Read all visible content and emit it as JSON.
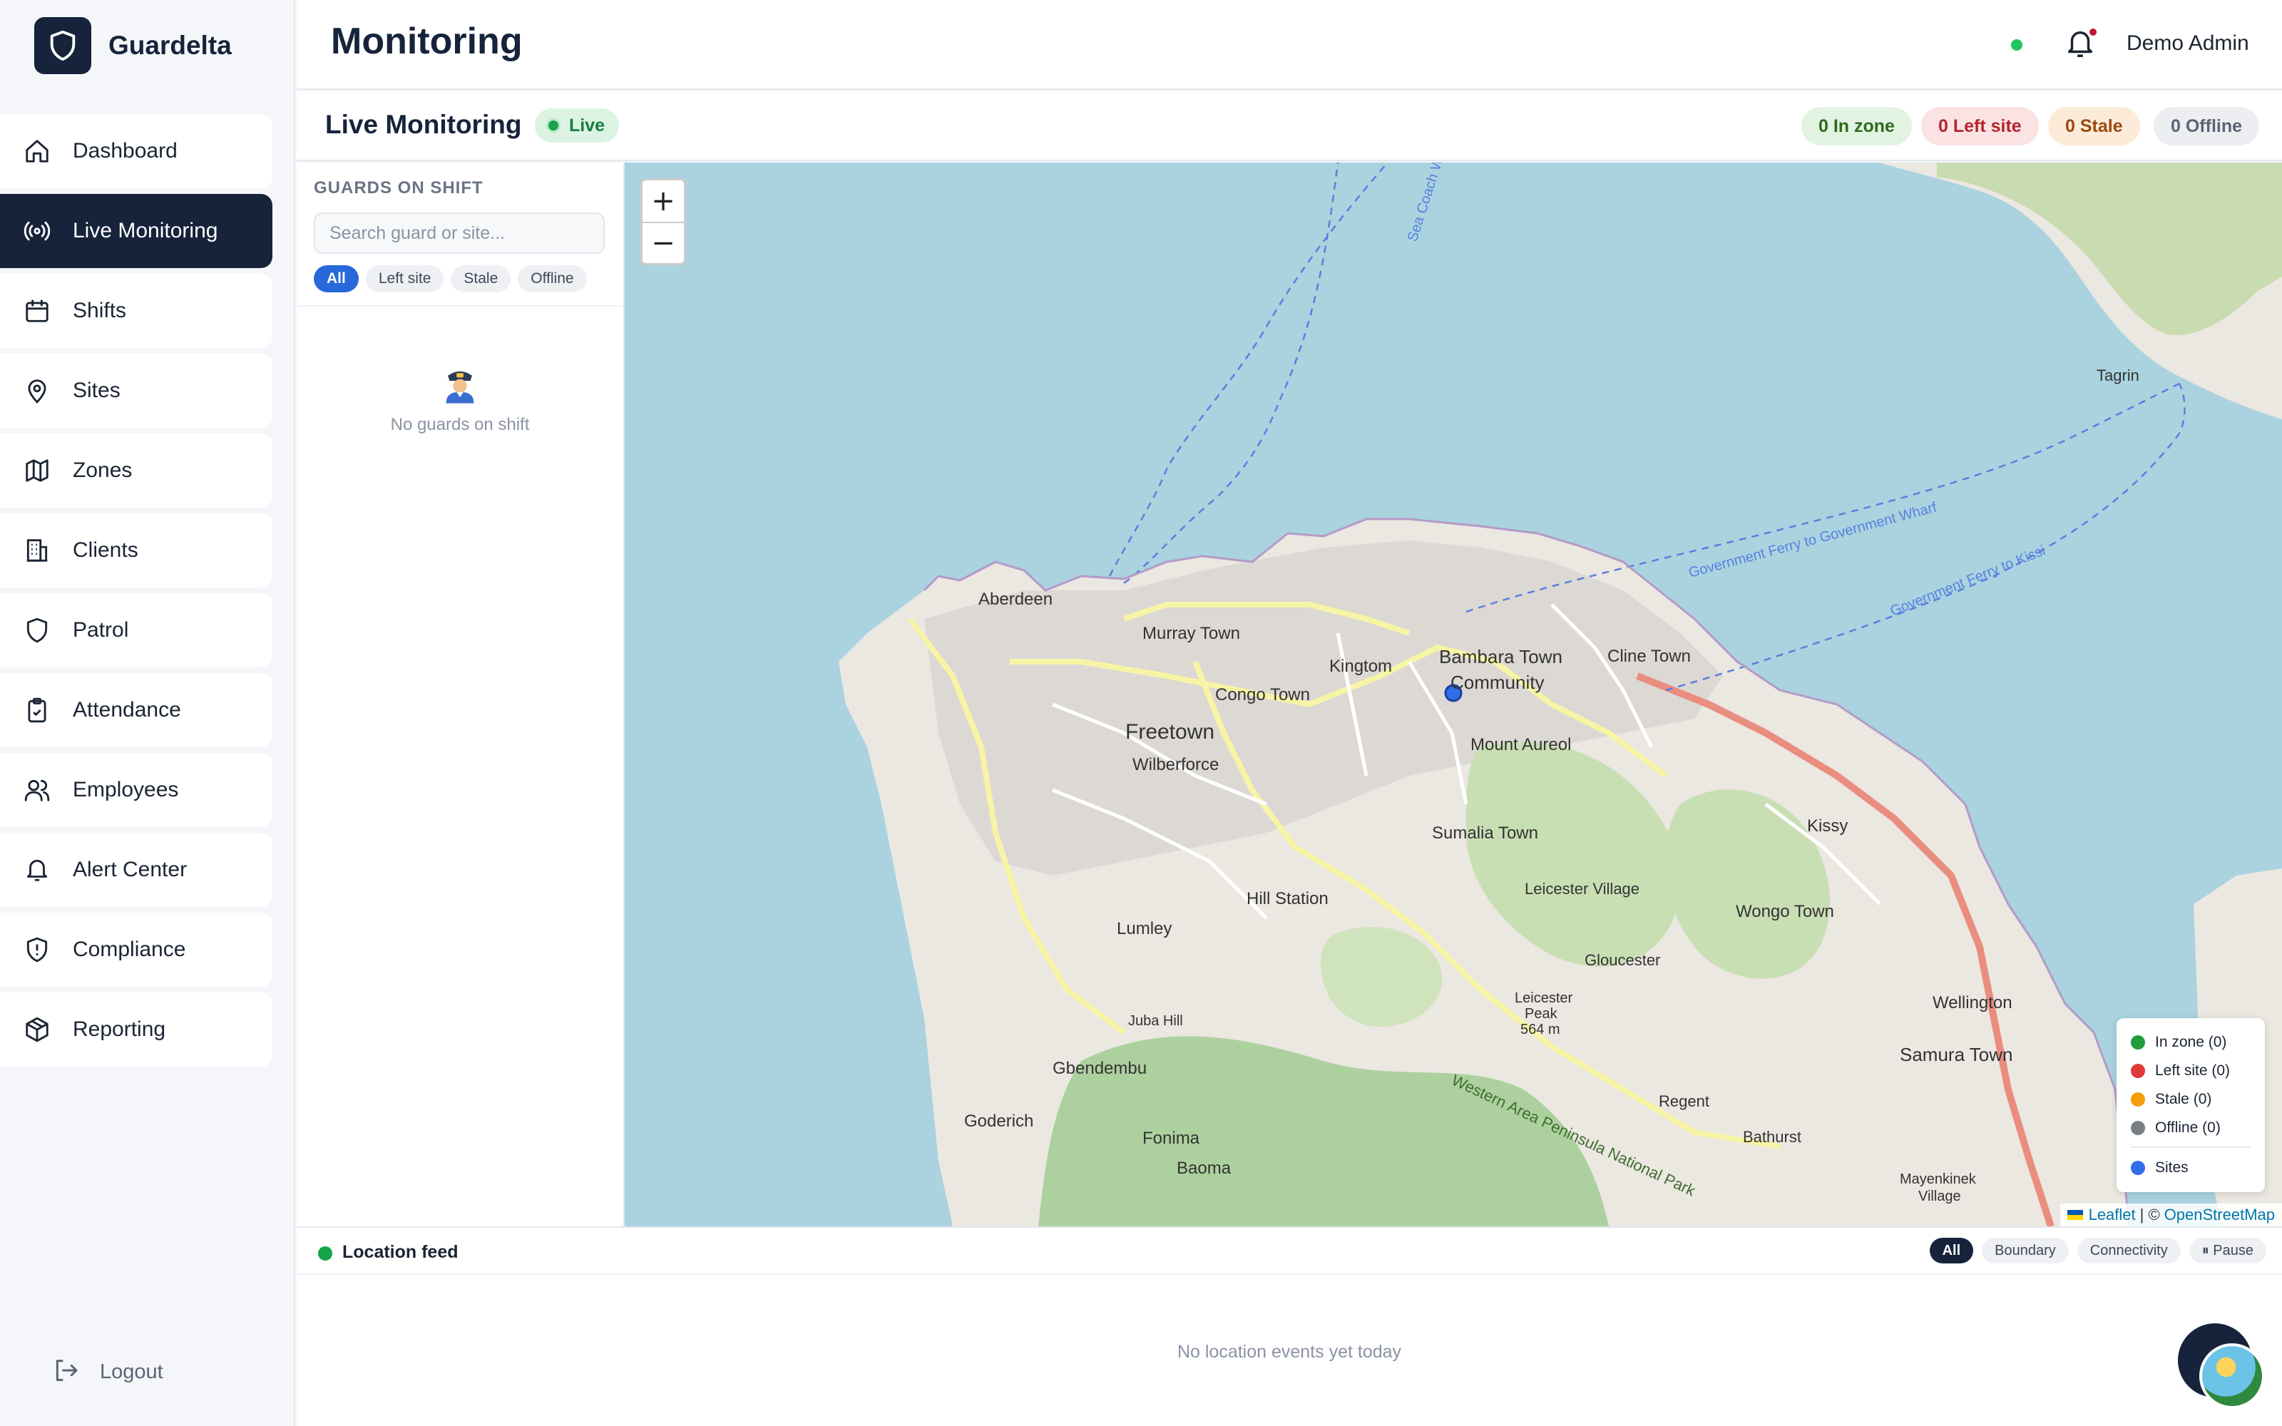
{
  "app": {
    "name": "Guardelta"
  },
  "sidebar": {
    "items": [
      {
        "label": "Dashboard",
        "icon": "home-icon"
      },
      {
        "label": "Live Monitoring",
        "icon": "broadcast-icon",
        "active": true
      },
      {
        "label": "Shifts",
        "icon": "calendar-icon"
      },
      {
        "label": "Sites",
        "icon": "map-pin-icon"
      },
      {
        "label": "Zones",
        "icon": "map-icon"
      },
      {
        "label": "Clients",
        "icon": "building-icon"
      },
      {
        "label": "Patrol",
        "icon": "shield-icon"
      },
      {
        "label": "Attendance",
        "icon": "clipboard-check-icon"
      },
      {
        "label": "Employees",
        "icon": "users-icon"
      },
      {
        "label": "Alert Center",
        "icon": "bell-icon"
      },
      {
        "label": "Compliance",
        "icon": "shield-alert-icon"
      },
      {
        "label": "Reporting",
        "icon": "package-icon"
      }
    ],
    "logout_label": "Logout"
  },
  "header": {
    "title": "Monitoring",
    "user_name": "Demo Admin",
    "status_color": "#22c55e"
  },
  "monitoring": {
    "title": "Live Monitoring",
    "live_label": "Live",
    "counts": {
      "in_zone": "0 In zone",
      "left_site": "0 Left site",
      "stale": "0 Stale",
      "offline": "0 Offline"
    }
  },
  "guards_panel": {
    "heading": "GUARDS ON SHIFT",
    "search_placeholder": "Search guard or site...",
    "filters": [
      "All",
      "Left site",
      "Stale",
      "Offline"
    ],
    "empty_text": "No guards on shift"
  },
  "map": {
    "zoom_in": "+",
    "zoom_out": "−",
    "labels": {
      "aberdeen": "Aberdeen",
      "murray_town": "Murray Town",
      "kingtom": "Kingtom",
      "bambara_town": "Bambara Town",
      "community": "Community",
      "cline_town": "Cline Town",
      "congo_town": "Congo Town",
      "freetown": "Freetown",
      "wilberforce": "Wilberforce",
      "mount_aureol": "Mount Aureol",
      "kissy": "Kissy",
      "sumalia_town": "Sumalia Town",
      "leicester_village": "Leicester Village",
      "hill_station": "Hill Station",
      "wongo_town": "Wongo Town",
      "lumley": "Lumley",
      "gloucester": "Gloucester",
      "leicester_peak": "Leicester",
      "leicester_peak_2": "Peak",
      "leicester_peak_elev": "564 m",
      "wellington": "Wellington",
      "juba_hill": "Juba Hill",
      "gbendembu": "Gbendembu",
      "samura_town": "Samura Town",
      "regent": "Regent",
      "goderich": "Goderich",
      "fonima": "Fonima",
      "bathurst": "Bathurst",
      "baoma": "Baoma",
      "mayenkinek": "Mayenkinek",
      "village": "Village",
      "tagrin": "Tagrin",
      "ferry_1": "Government Ferry to Government Wharf",
      "ferry_2": "Government Ferry to Kissi",
      "sea_coach": "Sea Coach W",
      "national_park": "Western Area Peninsula National Park"
    },
    "legend": [
      {
        "label": "In zone (0)",
        "color": "#1f9d3a"
      },
      {
        "label": "Left site (0)",
        "color": "#e03a3a"
      },
      {
        "label": "Stale (0)",
        "color": "#f59e0b"
      },
      {
        "label": "Offline (0)",
        "color": "#7a7f87"
      }
    ],
    "legend_sites": {
      "label": "Sites",
      "color": "#2f6fe8"
    },
    "attribution_leaflet": "Leaflet",
    "attribution_sep": "| ©",
    "attribution_osm": "OpenStreetMap"
  },
  "feed": {
    "title": "Location feed",
    "filters": [
      "All",
      "Boundary",
      "Connectivity",
      "⏸ Pause"
    ],
    "empty_text": "No location events yet today"
  }
}
